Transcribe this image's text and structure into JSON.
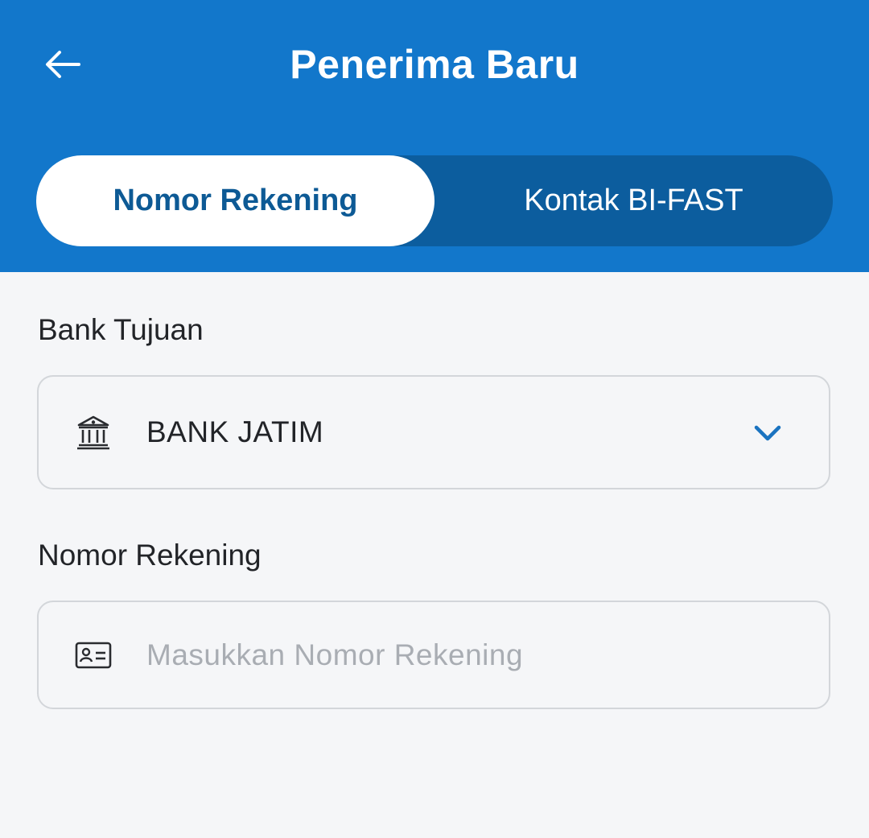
{
  "header": {
    "title": "Penerima Baru",
    "back_icon": "arrow-left-icon"
  },
  "tabs": [
    {
      "label": "Nomor Rekening",
      "active": true
    },
    {
      "label": "Kontak BI-FAST",
      "active": false
    }
  ],
  "bank_field": {
    "label": "Bank Tujuan",
    "value": "BANK JATIM",
    "icon": "bank-icon",
    "chevron_icon": "chevron-down-icon"
  },
  "account_field": {
    "label": "Nomor Rekening",
    "placeholder": "Masukkan Nomor Rekening",
    "value": "",
    "icon": "id-card-icon"
  },
  "colors": {
    "header_bg": "#1277cb",
    "segment_bg": "#0c5d9e",
    "active_tab_text": "#0d5a95",
    "chevron": "#1a73c0",
    "page_bg": "#f5f6f8"
  }
}
